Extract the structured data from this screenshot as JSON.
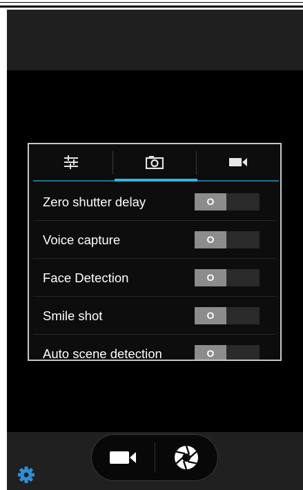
{
  "settings_panel": {
    "tabs": [
      {
        "icon": "sliders-icon",
        "active": false
      },
      {
        "icon": "camera-icon",
        "active": true
      },
      {
        "icon": "video-camera-icon",
        "active": false
      }
    ],
    "items": [
      {
        "label": "Zero shutter delay",
        "toggle": "O"
      },
      {
        "label": "Voice capture",
        "toggle": "O"
      },
      {
        "label": "Face Detection",
        "toggle": "O"
      },
      {
        "label": "Smile shot",
        "toggle": "O"
      },
      {
        "label": "Auto scene detection",
        "toggle": "O"
      }
    ]
  },
  "bottom_controls": {
    "left_icon": "gear-icon",
    "mode_buttons": [
      "video-camera-icon",
      "shutter-icon"
    ]
  },
  "colors": {
    "accent": "#33b5e5",
    "gear": "#2f8fd6",
    "toggle_off": "#8c8c8c"
  }
}
